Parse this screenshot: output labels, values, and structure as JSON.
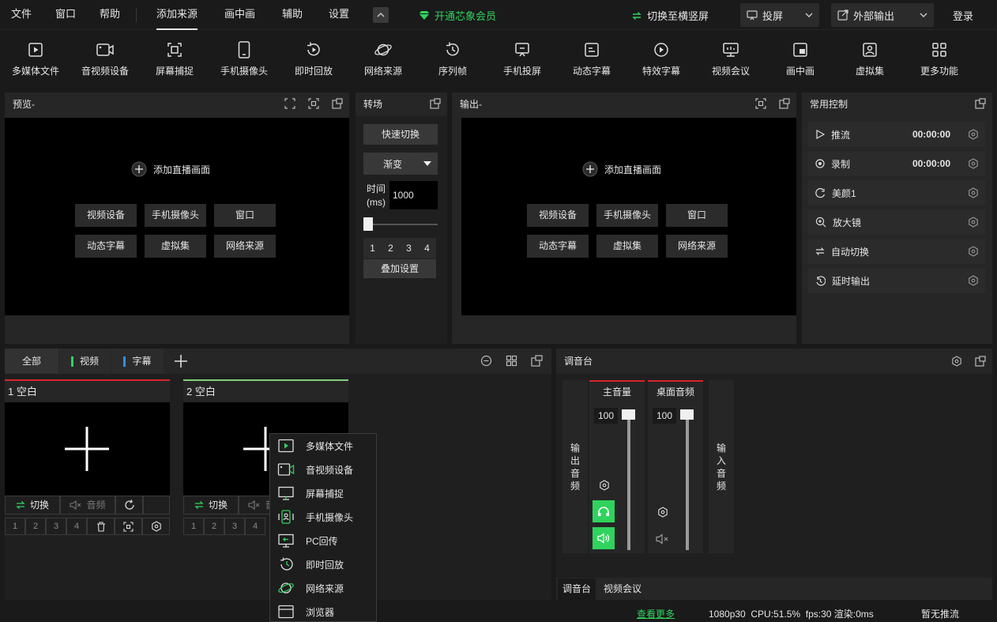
{
  "menu": {
    "file": "文件",
    "window": "窗口",
    "help": "帮助",
    "tabs": [
      "添加来源",
      "画中画",
      "辅助",
      "设置"
    ],
    "vip": "开通芯象会员",
    "switch_orientation": "切换至横竖屏",
    "cast": "投屏",
    "external_output": "外部输出",
    "login": "登录"
  },
  "toolbar": [
    {
      "label": "多媒体文件",
      "icon": "media-file-icon"
    },
    {
      "label": "音视频设备",
      "icon": "av-device-icon"
    },
    {
      "label": "屏幕捕捉",
      "icon": "screen-capture-icon"
    },
    {
      "label": "手机摄像头",
      "icon": "phone-camera-icon"
    },
    {
      "label": "即时回放",
      "icon": "instant-replay-icon"
    },
    {
      "label": "网络来源",
      "icon": "network-source-icon"
    },
    {
      "label": "序列帧",
      "icon": "sequence-frame-icon"
    },
    {
      "label": "手机投屏",
      "icon": "phone-cast-icon"
    },
    {
      "label": "动态字幕",
      "icon": "dynamic-subtitle-icon"
    },
    {
      "label": "特效字幕",
      "icon": "effect-subtitle-icon"
    },
    {
      "label": "视频会议",
      "icon": "video-conference-icon"
    },
    {
      "label": "画中画",
      "icon": "pip-icon"
    },
    {
      "label": "虚拟集",
      "icon": "virtual-set-icon"
    },
    {
      "label": "更多功能",
      "icon": "more-features-icon"
    }
  ],
  "preview": {
    "title": "预览-",
    "add": "添加直播画面",
    "buttons": [
      "视频设备",
      "手机摄像头",
      "窗口",
      "动态字幕",
      "虚拟集",
      "网络来源"
    ]
  },
  "transition": {
    "title": "转场",
    "quick_switch": "快速切换",
    "effect": "渐变",
    "time_label_1": "时间",
    "time_label_2": "(ms)",
    "time_value": "1000",
    "slider_value": 0,
    "numbers": [
      "1",
      "2",
      "3",
      "4"
    ],
    "overlay_settings": "叠加设置"
  },
  "output": {
    "title": "输出-",
    "add": "添加直播画面",
    "buttons": [
      "视频设备",
      "手机摄像头",
      "窗口",
      "动态字幕",
      "虚拟集",
      "网络来源"
    ]
  },
  "common_control": {
    "title": "常用控制",
    "rows": [
      {
        "name": "推流",
        "time": "00:00:00",
        "icon": "play-icon"
      },
      {
        "name": "录制",
        "time": "00:00:00",
        "icon": "record-icon"
      },
      {
        "name": "美颜1",
        "time": "",
        "icon": "beauty-icon"
      },
      {
        "name": "放大镜",
        "time": "",
        "icon": "magnifier-icon"
      },
      {
        "name": "自动切换",
        "time": "",
        "icon": "auto-switch-icon"
      },
      {
        "name": "延时输出",
        "time": "",
        "icon": "delay-output-icon"
      }
    ]
  },
  "scenes": {
    "tabs": [
      "全部",
      "视频",
      "字幕"
    ],
    "tab_colors": [
      "#2fd35d",
      "#2f8fff"
    ],
    "items": [
      {
        "title": "1 空白",
        "switch": "切换",
        "audio": "音频",
        "bar_color": "#d9242a"
      },
      {
        "title": "2 空白",
        "switch": "切换",
        "audio": "音频",
        "bar_color": "#7fd07a"
      }
    ],
    "nums": [
      "1",
      "2",
      "3",
      "4"
    ]
  },
  "context_menu": [
    {
      "label": "多媒体文件",
      "icon": "media-file-icon"
    },
    {
      "label": "音视频设备",
      "icon": "av-device-icon"
    },
    {
      "label": "屏幕捕捉",
      "icon": "screen-capture-icon"
    },
    {
      "label": "手机摄像头",
      "icon": "phone-camera-icon"
    },
    {
      "label": "PC回传",
      "icon": "pc-return-icon"
    },
    {
      "label": "即时回放",
      "icon": "instant-replay-icon"
    },
    {
      "label": "网络来源",
      "icon": "network-source-icon"
    },
    {
      "label": "浏览器",
      "icon": "browser-icon"
    }
  ],
  "mixer": {
    "title": "调音台",
    "output_audio": [
      "输",
      "出",
      "音",
      "频"
    ],
    "input_audio": [
      "输",
      "入",
      "音",
      "频"
    ],
    "channels": [
      {
        "name": "主音量",
        "value": "100",
        "level": 1.0
      },
      {
        "name": "桌面音频",
        "value": "100",
        "level": 1.0
      }
    ],
    "bottom_tabs": [
      "调音台",
      "视频会议"
    ]
  },
  "status": {
    "more": "查看更多",
    "info": "1080p30  CPU:51.5%  fps:30 渲染:0ms",
    "stream": "暂无推流"
  },
  "colors": {
    "accent_green": "#2fd35d",
    "preview_bar": "#7fd07a",
    "output_bar": "#d9242a"
  }
}
